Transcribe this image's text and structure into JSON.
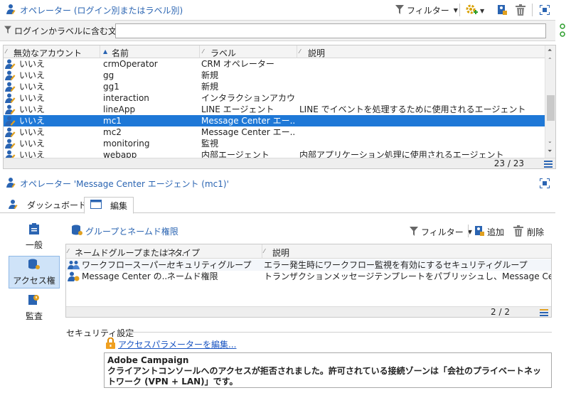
{
  "top_panel": {
    "title": "オペレーター (ログイン別またはラベル別)",
    "filter_label": "フィルター",
    "search_label": "ログインかラベルに含む文字:",
    "search_value": "",
    "grid": {
      "columns": [
        "無効なアカウント",
        "名前",
        "ラベル",
        "説明"
      ],
      "rows": [
        {
          "disabled": "いいえ",
          "name": "crmOperator",
          "label": "CRM オペレーター",
          "desc": ""
        },
        {
          "disabled": "いいえ",
          "name": "gg",
          "label": "新規",
          "desc": ""
        },
        {
          "disabled": "いいえ",
          "name": "gg1",
          "label": "新規",
          "desc": ""
        },
        {
          "disabled": "いいえ",
          "name": "interaction",
          "label": "インタラクションアカウント",
          "desc": ""
        },
        {
          "disabled": "いいえ",
          "name": "lineApp",
          "label": "LINE エージェント",
          "desc": "LINE でイベントを処理するために使用されるエージェント"
        },
        {
          "disabled": "いいえ",
          "name": "mc1",
          "label": "Message Center エー...",
          "desc": "",
          "selected": true
        },
        {
          "disabled": "いいえ",
          "name": "mc2",
          "label": "Message Center エー...",
          "desc": ""
        },
        {
          "disabled": "いいえ",
          "name": "monitoring",
          "label": "監視",
          "desc": ""
        },
        {
          "disabled": "いいえ",
          "name": "webapp",
          "label": "内部エージェント",
          "desc": "内部アプリケーション処理に使用されるエージェント"
        }
      ],
      "count": "23 / 23"
    }
  },
  "detail_panel": {
    "title": "オペレーター 'Message Center エージェント (mc1)'",
    "tabs": [
      {
        "label": "ダッシュボード",
        "active": false
      },
      {
        "label": "編集",
        "active": true
      }
    ],
    "nav": [
      {
        "label": "一般",
        "active": false
      },
      {
        "label": "アクセス権",
        "active": true
      },
      {
        "label": "監査",
        "active": false
      }
    ],
    "section_title": "グループとネームド権限",
    "filter_label": "フィルター",
    "add_label": "追加",
    "delete_label": "削除",
    "grid": {
      "columns": [
        "ネームドグループまたはネ...",
        "タイプ",
        "説明"
      ],
      "rows": [
        {
          "name": "ワークフロースーパーバ...",
          "type": "セキュリティグループ",
          "desc": "エラー発生時にワークフロー監視を有効にするセキュリティグループ",
          "icon": "group"
        },
        {
          "name": "Message Center の...",
          "type": "ネームド権限",
          "desc": "トランザクションメッセージテンプレートをパブリッシュし、Message Center の処理キュー.",
          "icon": "right"
        }
      ],
      "count": "2 / 2"
    },
    "security": {
      "label": "セキュリティ設定",
      "link": "アクセスパラメーターを編集...",
      "message_title": "Adobe Campaign",
      "message_body": "クライアントコンソールへのアクセスが拒否されました。許可されている接続ゾーンは「会社のプライベートネットワーク (VPN + LAN)」です。"
    }
  },
  "colors": {
    "accent": "#2a64b2",
    "selection": "#1e78d7",
    "nav_active": "#cfe3f8",
    "link": "#1a55c2"
  }
}
